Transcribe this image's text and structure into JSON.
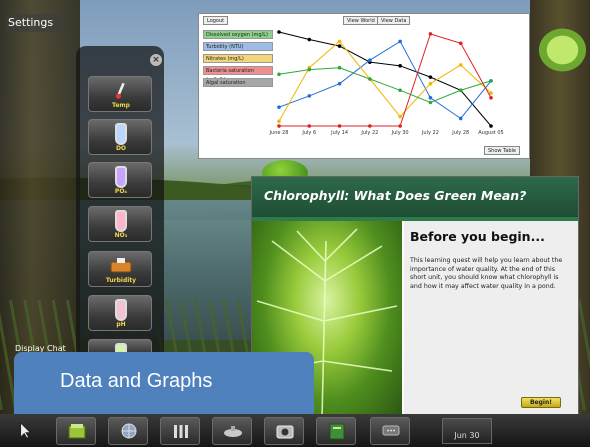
{
  "settings_label": "Settings",
  "palette": {
    "close_glyph": "×",
    "tools": [
      {
        "label": "Temp",
        "icon": "thermometer-icon"
      },
      {
        "label": "DO",
        "icon": "test-tube-icon"
      },
      {
        "label": "PO₄",
        "icon": "test-tube-icon"
      },
      {
        "label": "NO₃",
        "icon": "test-tube-icon"
      },
      {
        "label": "Turbidity",
        "icon": "turbidity-kit-icon"
      },
      {
        "label": "pH",
        "icon": "test-tube-icon"
      },
      {
        "label": "",
        "icon": "test-tube-icon"
      }
    ]
  },
  "chat_label": "Display Chat",
  "graph": {
    "buttons": {
      "logout": "Logout",
      "view_world": "View World",
      "view_data": "View Data",
      "show_table": "Show Table"
    },
    "legend": [
      {
        "name": "Dissolved oxygen (mg/L)",
        "color": "#8fd18a"
      },
      {
        "name": "Turbidity (NTU)",
        "color": "#9dbde6"
      },
      {
        "name": "Nitrates (mg/L)",
        "color": "#f3d67a"
      },
      {
        "name": "Bacteria saturation (cells/L)",
        "color": "#ef8f8f"
      },
      {
        "name": "Algal saturation",
        "color": "#a7a7a7"
      }
    ]
  },
  "chart_data": {
    "type": "line",
    "categories": [
      "June 28",
      "July 6",
      "July 14",
      "July 22",
      "July 30",
      "July 22",
      "July 28",
      "August 05"
    ],
    "series": [
      {
        "color": "#000000",
        "values": [
          100,
          92,
          85,
          68,
          64,
          52,
          38,
          0
        ]
      },
      {
        "color": "#1e6fd9",
        "values": [
          20,
          32,
          45,
          70,
          90,
          30,
          8,
          48
        ]
      },
      {
        "color": "#f2b600",
        "values": [
          5,
          62,
          90,
          50,
          10,
          45,
          65,
          35
        ]
      },
      {
        "color": "#e22020",
        "values": [
          0,
          0,
          0,
          0,
          0,
          98,
          88,
          30
        ]
      },
      {
        "color": "#2fa83a",
        "values": [
          55,
          60,
          62,
          50,
          38,
          25,
          38,
          48
        ]
      }
    ],
    "ylim": [
      0,
      100
    ]
  },
  "quest": {
    "title": "Chlorophyll: What Does Green Mean?",
    "heading": "Before you begin...",
    "body": "This learning quest will help you learn about the importance of water quality. At the end of this short unit, you should know what chlorophyll is and how it may affect water quality in a pond.",
    "begin_label": "Begin!"
  },
  "caption": "Data and Graphs",
  "toolbar": {
    "date": "Jun 30",
    "buttons": [
      "cursor-icon",
      "field-notebook-icon",
      "globe-icon",
      "measurement-tools-icon",
      "submarine-icon",
      "camera-icon",
      "journal-icon",
      "chat-icon"
    ]
  }
}
